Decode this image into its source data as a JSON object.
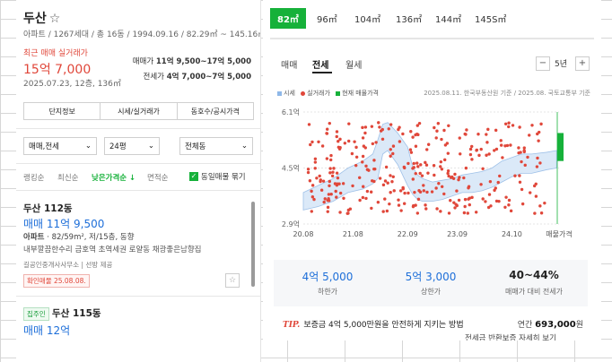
{
  "listing": {
    "title": "두산",
    "star_icon": "☆",
    "meta": "아파트 / 1267세대 / 총 16동 / 1994.09.16 / 82.29㎡ ~ 145.16㎡",
    "recent_label": "최근 매매 실거래가",
    "recent_price": "15억 7,000",
    "recent_date": "2025.07.23, 12층, 136㎡",
    "sale_range_label": "매매가",
    "sale_range_value": "11억 9,500~17억 5,000",
    "jeonse_range_label": "전세가",
    "jeonse_range_value": "4억 7,000~7억 5,000",
    "buttons": [
      "단지정보",
      "시세/실거래가",
      "동호수/공시가격"
    ]
  },
  "filters": {
    "trade_type": "매매,전세",
    "size": "24평",
    "dong": "전체동"
  },
  "sort": {
    "options": [
      "랭킹순",
      "최신순",
      "낮은가격순 ↓",
      "면적순"
    ],
    "active_index": 2,
    "same_listing_label": "동일매물 묶기"
  },
  "items": [
    {
      "title": "두산 112동",
      "price": "매매 11억 9,500",
      "spec_bold": "아파트",
      "spec": " · 82/59m², 저/15층, 동향",
      "desc": "내부깔끔한수리 금호역 초역세권 로얄동 채광좋은남향집",
      "agent": "길공인중개사사무소  |  선방 제공",
      "badge": "확인매물 25.08.08."
    },
    {
      "badge": "집주인",
      "title": "두산 115동",
      "price": "매매 12억"
    }
  ],
  "area_tabs": [
    "82㎡",
    "96㎡",
    "104㎡",
    "136㎡",
    "144㎡",
    "145S㎡"
  ],
  "detail_tabs": [
    "매매",
    "전세",
    "월세"
  ],
  "period": "5년",
  "minus_label": "−",
  "plus_label": "+",
  "colors": {
    "accent": "#16b13a",
    "price_blue": "#1e6fd9",
    "trade_red": "#e0473a"
  },
  "legend": {
    "market": "시세",
    "actual": "실거래가",
    "current": "현재 매물가격"
  },
  "source_note": "2025.08.11. 한국부동산원 기준 / 2025.08. 국토교통부 기준",
  "chart_data": {
    "type": "scatter",
    "y_ticks": [
      "6.1억",
      "4.5억",
      "2.9억"
    ],
    "x_ticks": [
      "20.08",
      "21.08",
      "22.09",
      "23.09",
      "24.10",
      "매물가격"
    ],
    "ylim": [
      2.9,
      6.1
    ],
    "xlim": [
      2020.6,
      2025.75
    ],
    "current_range": [
      4.7,
      5.5
    ],
    "band": {
      "x": [
        2020.6,
        2020.9,
        2021.2,
        2021.5,
        2021.8,
        2022.0,
        2022.1,
        2022.2,
        2022.3,
        2022.5,
        2022.7,
        2022.8,
        2022.9,
        2023.0,
        2023.2,
        2023.4,
        2023.6,
        2023.8,
        2024.0,
        2024.2,
        2024.4,
        2024.6,
        2024.8,
        2025.0,
        2025.2,
        2025.5,
        2025.7
      ],
      "low": [
        3.3,
        3.4,
        3.55,
        3.8,
        3.9,
        4.05,
        4.2,
        4.9,
        5.0,
        4.6,
        4.0,
        3.75,
        3.6,
        3.55,
        3.55,
        3.6,
        3.7,
        3.8,
        3.8,
        3.85,
        3.95,
        4.1,
        4.25,
        4.35,
        4.35,
        4.45,
        4.5
      ],
      "high": [
        3.8,
        4.0,
        4.2,
        4.5,
        4.7,
        4.9,
        5.3,
        5.75,
        5.8,
        5.5,
        5.1,
        4.55,
        4.3,
        4.2,
        4.1,
        4.15,
        4.2,
        4.3,
        4.35,
        4.4,
        4.5,
        4.7,
        4.8,
        4.9,
        4.9,
        4.95,
        5.0
      ]
    }
  },
  "stats": [
    {
      "value": "4억 5,000",
      "label": "하한가"
    },
    {
      "value": "5억 3,000",
      "label": "상한가"
    },
    {
      "value": "40~44%",
      "label": "매매가 대비 전세가"
    }
  ],
  "tip": {
    "prefix": "TIP.",
    "text": "보증금 4억 5,000만원을 안전하게 지키는 방법"
  },
  "monthly": {
    "label": "연간",
    "value": "693,000",
    "unit": "원"
  },
  "more_text": "전세금 반환보증 자세히 보기"
}
